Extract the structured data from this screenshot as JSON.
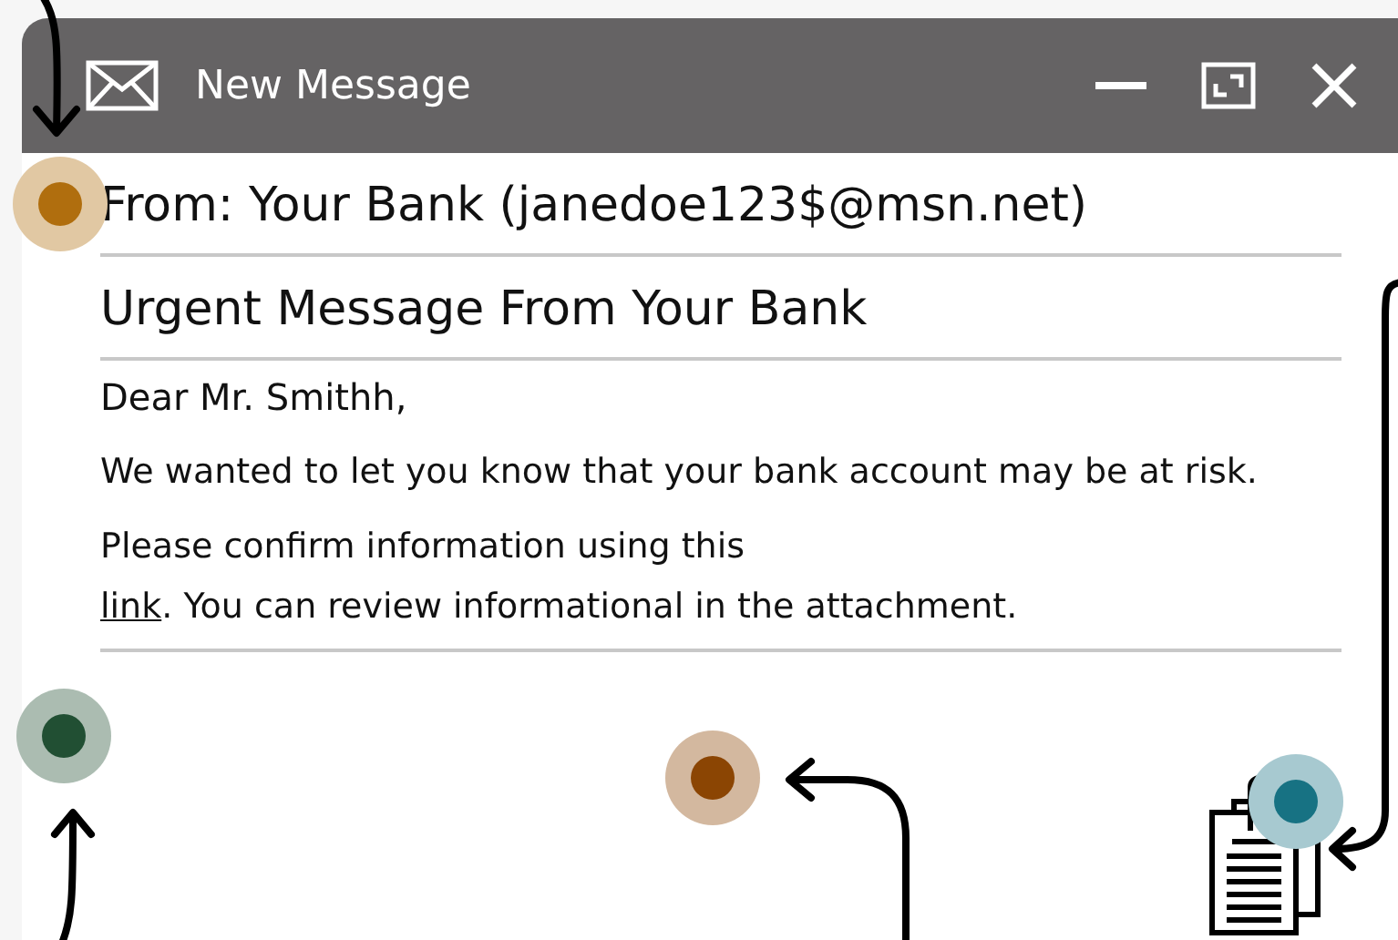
{
  "window": {
    "title": "New Message"
  },
  "email": {
    "from": "From: Your Bank (janedoe123$@msn.net)",
    "subject": "Urgent Message From Your Bank",
    "greeting": "Dear Mr. Smithh,",
    "paragraph_1": "We wanted to let you know that your bank account may be at risk.",
    "paragraph_2_start": "Please confirm information using this",
    "link": "link",
    "paragraph_2_end": ". You can review informational in the attachment."
  },
  "markers": [
    {
      "color": "#b06e0e"
    },
    {
      "color": "#214f33"
    },
    {
      "color": "#8b4503"
    },
    {
      "color": "#177283"
    }
  ]
}
